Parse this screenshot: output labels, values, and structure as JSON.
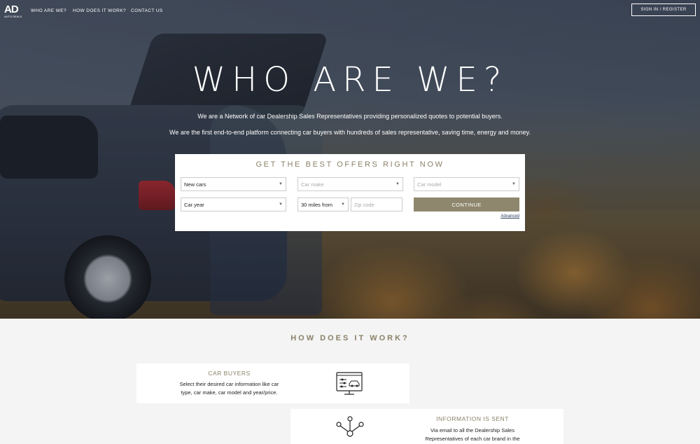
{
  "nav": {
    "logo_text": "AD",
    "logo_subtext": "AUTO DEALS",
    "links": [
      "WHO ARE WE?",
      "HOW DOES IT WORK?",
      "CONTACT US"
    ],
    "signin_label": "SIGN IN / REGISTER"
  },
  "hero": {
    "title": "WHO ARE WE?",
    "paragraph_1": "We are a Network of car Dealership Sales Representatives providing personalized quotes to potential buyers.",
    "paragraph_2": "We are the first end-to-end platform connecting car buyers with hundreds of sales representative, saving time, energy and money."
  },
  "search": {
    "title": "GET THE BEST OFFERS RIGHT NOW",
    "condition_value": "New cars",
    "make_placeholder": "Car make",
    "model_placeholder": "Car model",
    "year_value": "Car year",
    "distance_value": "30 miles from",
    "zip_placeholder": "Zip code",
    "continue_label": "CONTINUE",
    "advanced_label": "Advanced"
  },
  "how": {
    "title": "HOW DOES IT WORK?",
    "cards": [
      {
        "title": "CAR BUYERS",
        "text_line_1": "Select their desired car information like car",
        "text_line_2": "type, car make, car model and year/price.",
        "icon": "monitor-car-icon"
      },
      {
        "title": "INFORMATION IS SENT",
        "text_line_1": "Via email to all the Dealership Sales",
        "text_line_2": "Representatives of each car brand in the",
        "icon": "network-icon"
      }
    ]
  },
  "colors": {
    "accent": "#8e876d",
    "heading": "#8a8168"
  }
}
